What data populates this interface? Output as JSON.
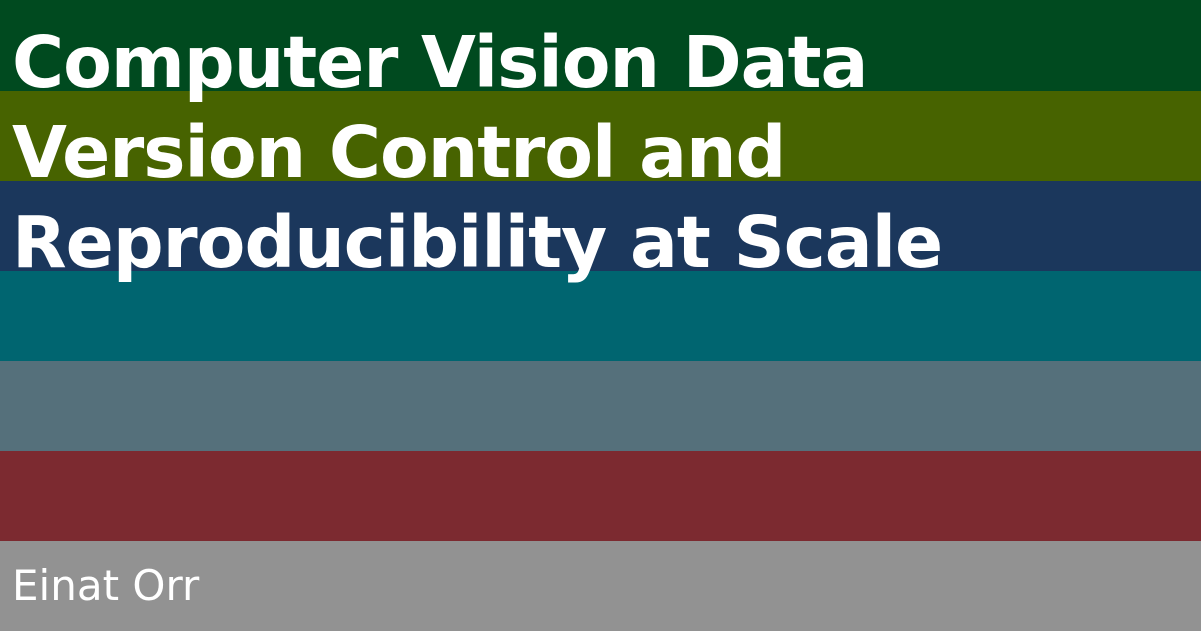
{
  "title_lines": [
    "Computer Vision Data",
    "Version Control and",
    "Reproducibility at Scale"
  ],
  "author": "Einat Orr",
  "colors": {
    "stripes": [
      "#004a1f",
      "#476300",
      "#1b375c",
      "#006570",
      "#55707b",
      "#7c2a30",
      "#929292"
    ],
    "text": "#ffffff"
  }
}
